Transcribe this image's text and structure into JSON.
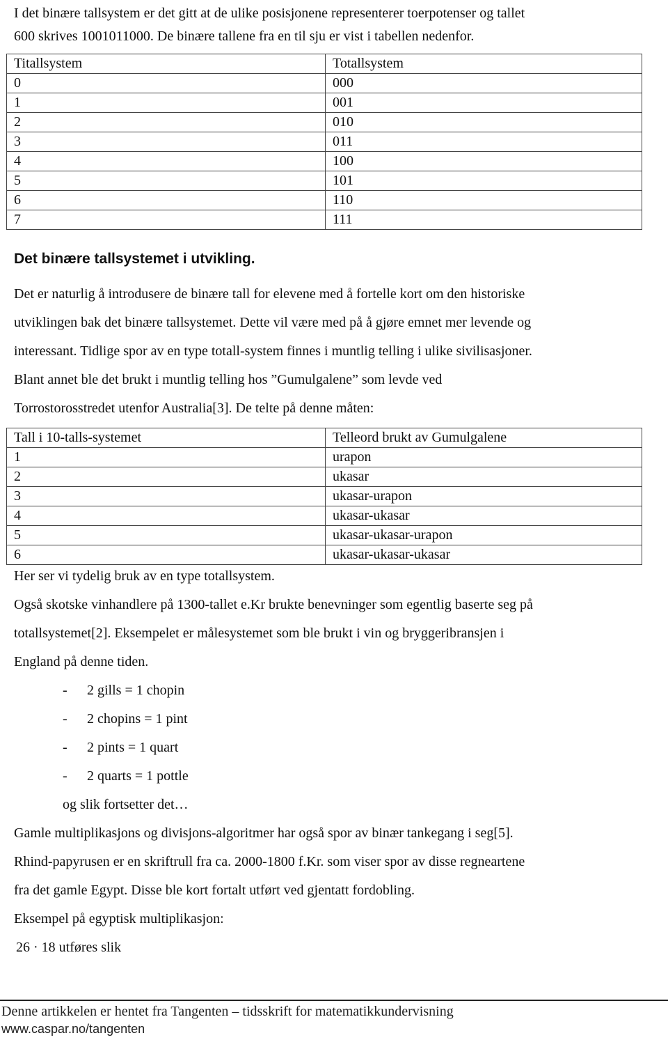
{
  "intro": {
    "line1": "I det binære tallsystem er det gitt at de ulike posisjonene representerer toerpotenser og tallet",
    "line2": "600 skrives 1001011000. De binære tallene fra en til sju er vist i tabellen nedenfor."
  },
  "binary_table": {
    "headers": [
      "Titallsystem",
      "Totallsystem"
    ],
    "rows": [
      [
        "0",
        "000"
      ],
      [
        "1",
        "001"
      ],
      [
        "2",
        "010"
      ],
      [
        "3",
        "011"
      ],
      [
        "4",
        "100"
      ],
      [
        "5",
        "101"
      ],
      [
        "6",
        "110"
      ],
      [
        "7",
        "111"
      ]
    ]
  },
  "section": {
    "heading": "Det binære tallsystemet i utvikling.",
    "para1": [
      "Det er naturlig å introdusere de binære tall for elevene med å fortelle kort om den historiske",
      "utviklingen bak det binære tallsystemet. Dette vil være med på å gjøre emnet mer levende og",
      "interessant. Tidlige spor av en type totall-system finnes i muntlig telling i ulike sivilisasjoner.",
      "Blant annet ble det brukt i muntlig telling hos ”Gumulgalene” som levde ved",
      "Torrostorosstredet utenfor Australia[3]. De telte på denne måten:"
    ]
  },
  "gumulgal_table": {
    "headers": [
      "Tall i 10-talls-systemet",
      "Telleord brukt av Gumulgalene"
    ],
    "rows": [
      [
        "1",
        "urapon"
      ],
      [
        "2",
        "ukasar"
      ],
      [
        "3",
        "ukasar-urapon"
      ],
      [
        "4",
        "ukasar-ukasar"
      ],
      [
        "5",
        "ukasar-ukasar-urapon"
      ],
      [
        "6",
        "ukasar-ukasar-ukasar"
      ]
    ]
  },
  "after_table": "Her ser vi tydelig bruk av en type totallsystem.",
  "para2": [
    "Også skotske vinhandlere på 1300-tallet e.Kr brukte benevninger som egentlig baserte seg på",
    "totallsystemet[2]. Eksempelet er målesystemet som ble brukt i vin og bryggeribransjen i",
    "England på denne tiden."
  ],
  "measures": {
    "dash": "-",
    "items": [
      "2 gills = 1 chopin",
      "2 chopins = 1 pint",
      "2 pints = 1 quart",
      "2 quarts = 1 pottle"
    ],
    "continuation": "og slik fortsetter det…"
  },
  "para3": [
    "Gamle multiplikasjons og divisjons-algoritmer har også spor av binær tankegang i seg[5].",
    "Rhind-papyrusen er en skriftrull fra ca. 2000-1800 f.Kr. som viser spor av disse regneartene",
    "fra det gamle Egypt. Disse ble kort fortalt utført ved gjentatt fordobling."
  ],
  "example": {
    "label": "Eksempel på egyptisk multiplikasjon:",
    "expression": "26 · 18",
    "suffix": "utføres slik"
  },
  "footer": {
    "line1": "Denne artikkelen er hentet fra Tangenten – tidsskrift for matematikkundervisning",
    "line2": "www.caspar.no/tangenten"
  }
}
